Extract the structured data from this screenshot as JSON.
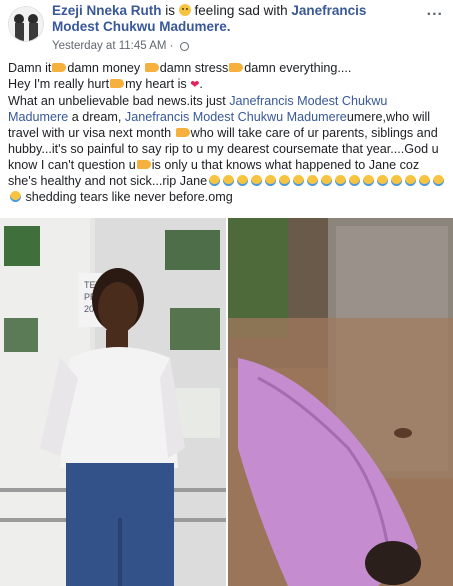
{
  "post": {
    "author": "Ezeji Nneka Ruth",
    "is_text": " is ",
    "feeling_text": " feeling sad with ",
    "tagged": "Janefrancis Modest Chukwu Madumere.",
    "timestamp": "Yesterday at 11:45 AM",
    "dot": " · ",
    "more": "...",
    "lines": {
      "l1a": "Damn it",
      "l1b": "damn money ",
      "l1c": "damn stress",
      "l1d": "damn everything....",
      "l2a": "Hey I'm really hurt",
      "l2b": "my heart is ",
      "l2c": ".",
      "l3a": "What an unbelievable bad news.its just ",
      "l3link1": "Janefrancis Modest Chukwu Madumere",
      "l3b": " a dream, ",
      "l3link2": "Janefrancis Modest Chukwu Madumere",
      "l3c": "umere,who will travel with ur visa next month ",
      "l3d": "who will take care of ur parents, siblings and hubby...it's so painful to say rip to u my dearest coursemate that year....God u know I can't question u",
      "l3e": "is only u that knows what happened to Jane coz she's healthy and not sick...rip Jane",
      "l3f": " shedding tears like never before.omg"
    }
  },
  "photo_sign": {
    "line1": "TET",
    "line2": "PRO",
    "line3": "201"
  },
  "icons": {
    "avatar": "profile-avatar",
    "feeling": "sad-face-emoji",
    "pointing": "pointing-hand-emoji",
    "heart": "broken-heart-emoji",
    "crying": "loudly-crying-emoji",
    "privacy": "globe-icon",
    "options": "more-options-icon"
  },
  "colors": {
    "link": "#385898",
    "text": "#1c1e21",
    "meta": "#616770"
  }
}
